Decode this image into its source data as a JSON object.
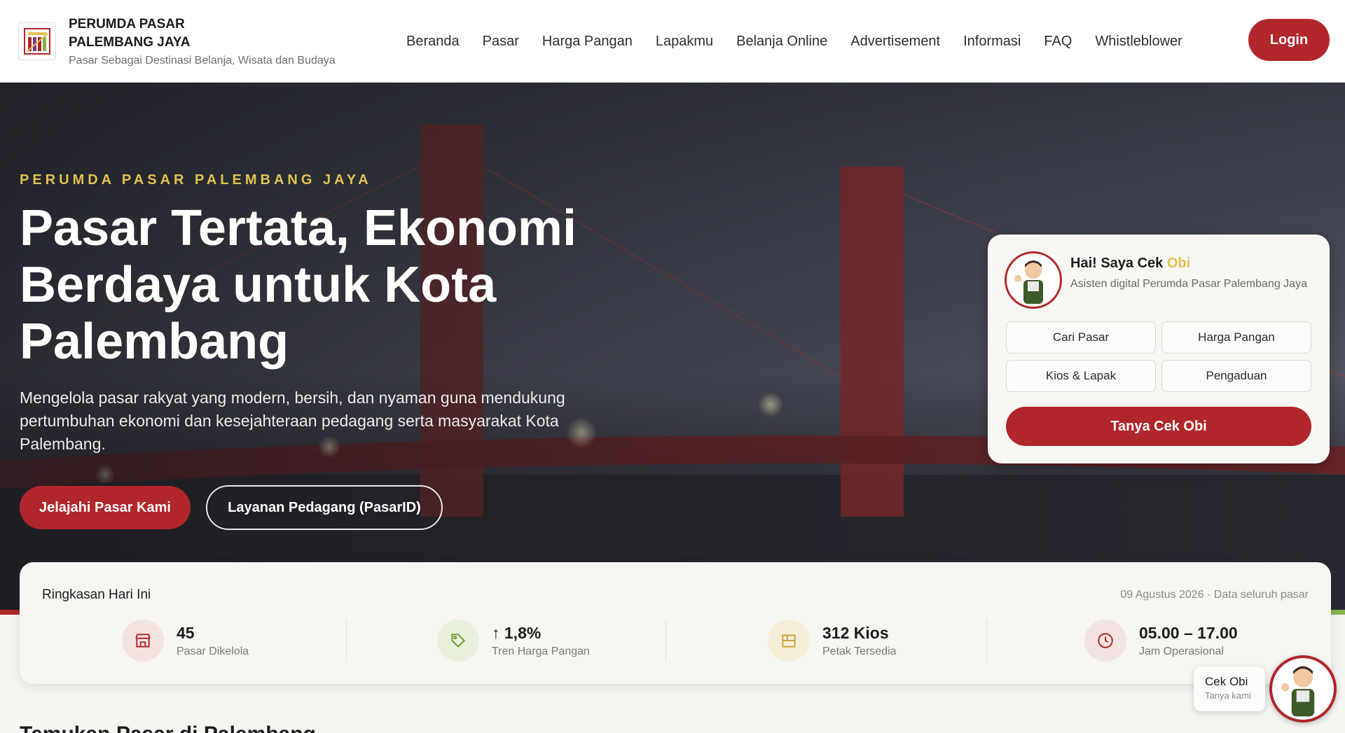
{
  "header": {
    "brand_name": "PERUMDA PASAR PALEMBANG JAYA",
    "tagline": "Pasar Sebagai Destinasi Belanja, Wisata dan Budaya",
    "nav": [
      "Beranda",
      "Pasar",
      "Harga Pangan",
      "Lapakmu",
      "Belanja Online",
      "Advertisement",
      "Informasi",
      "FAQ",
      "Whistleblower"
    ],
    "login_label": "Login"
  },
  "hero": {
    "eyebrow": "PERUMDA PASAR PALEMBANG JAYA",
    "title": "Pasar Tertata, Ekonomi Berdaya untuk Kota Palembang",
    "description": "Mengelola pasar rakyat yang modern, bersih, dan nyaman guna mendukung pertumbuhan ekonomi dan kesejahteraan pedagang serta masyarakat Kota Palembang.",
    "primary_button": "Jelajahi Pasar Kami",
    "secondary_button": "Layanan Pedagang (PasarID)"
  },
  "assistant_card": {
    "greeting_prefix": "Hai! Saya Cek ",
    "greeting_name": "Obi",
    "subtitle": "Asisten digital Perumda Pasar Palembang Jaya",
    "quick_actions": [
      "Cari Pasar",
      "Harga Pangan",
      "Kios & Lapak",
      "Pengaduan"
    ],
    "cta_label": "Tanya Cek Obi"
  },
  "summary": {
    "title": "Ringkasan Hari Ini",
    "date_note": "09 Agustus 2026 · Data seluruh pasar",
    "stats": [
      {
        "value": "45",
        "label": "Pasar Dikelola",
        "icon": "store-icon"
      },
      {
        "value": "↑ 1,8%",
        "label": "Tren Harga Pangan",
        "icon": "price-tag-icon"
      },
      {
        "value": "312 Kios",
        "label": "Petak Tersedia",
        "icon": "kiosk-icon"
      },
      {
        "value": "05.00 – 17.00",
        "label": "Jam Operasional",
        "icon": "clock-icon"
      }
    ]
  },
  "next_section_title": "Temukan Pasar di Palembang",
  "floating_widget": {
    "name": "Cek Obi",
    "subtitle": "Tanya kami"
  },
  "colors": {
    "brand_red": "#b0262b",
    "accent_gold": "#e2c24f",
    "accent_green": "#86b24a"
  }
}
